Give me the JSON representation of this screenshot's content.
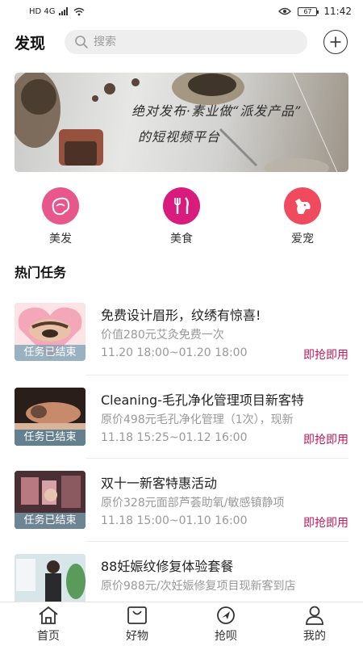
{
  "status_bar": {
    "left_indicators": "HD 4G",
    "time": "11:42",
    "battery": "67"
  },
  "header": {
    "title": "发现",
    "search_placeholder": "搜索"
  },
  "banner": {
    "line1": "绝对发布·素业做“派发产品”",
    "line2": "的短视频平台"
  },
  "categories": [
    {
      "label": "美发",
      "icon": "hair-icon",
      "color": "#e8578b"
    },
    {
      "label": "美食",
      "icon": "food-icon",
      "color": "#d81b7c"
    },
    {
      "label": "爱宠",
      "icon": "pet-icon",
      "color": "#ef4a5d"
    }
  ],
  "section": {
    "title": "热门任务"
  },
  "tasks": [
    {
      "title": "免费设计眉形，纹绣有惊喜!",
      "desc": "价值280元艾灸免费一次",
      "time": "11.20 18:00~01.20 18:00",
      "tag": "即抢即用",
      "badge": "任务已结束"
    },
    {
      "title": "Cleaning-毛孔净化管理项目新客特",
      "desc": "原价498元毛孔净化管理（1次），现新",
      "time": "11.18 15:25~01.12 16:00",
      "tag": "即抢即用",
      "badge": "任务已结束"
    },
    {
      "title": "双十一新客特惠活动",
      "desc": "原价328元面部芦荟助氧/敏感镇静项",
      "time": "11.18 15:00~01.10 16:00",
      "tag": "即抢即用",
      "badge": "任务已结束"
    },
    {
      "title": "88妊娠纹修复体验套餐",
      "desc": "原价988元/次妊娠修复项目现新客到店",
      "time": "",
      "tag": "",
      "badge": ""
    }
  ],
  "nav": [
    {
      "label": "首页",
      "icon": "home-icon"
    },
    {
      "label": "好物",
      "icon": "shopping-bag-icon"
    },
    {
      "label": "抢呗",
      "icon": "navigation-icon"
    },
    {
      "label": "我的",
      "icon": "user-icon"
    }
  ],
  "colors": {
    "accent": "#c2185b",
    "search_bg": "#eeeeee"
  }
}
